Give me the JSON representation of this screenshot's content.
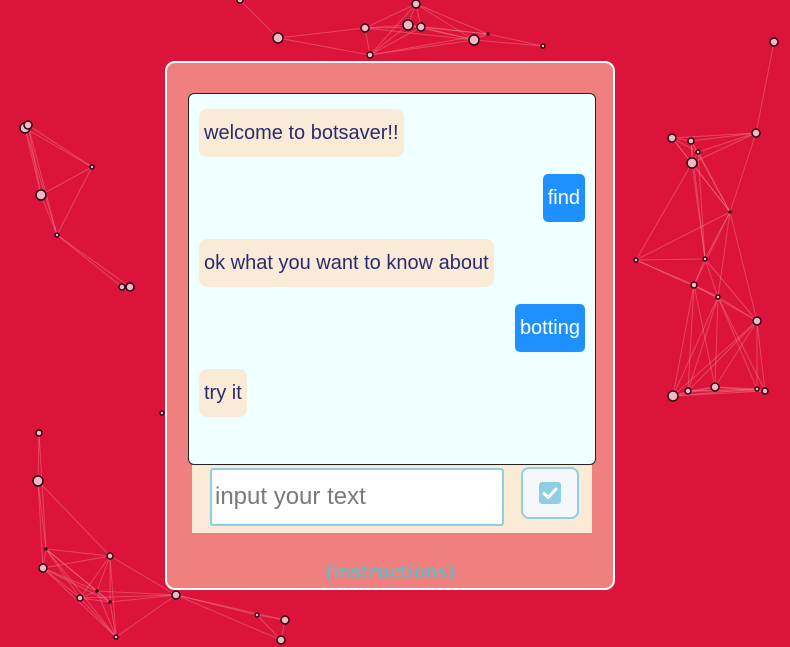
{
  "colors": {
    "background": "#dc143c",
    "panel": "#f08080",
    "chat_background": "#f0ffff",
    "bot_bubble": "#faebd7",
    "user_bubble": "#1e90ff",
    "link": "#23d5e0"
  },
  "chat": {
    "messages": [
      {
        "sender": "bot",
        "text": "welcome to botsaver!!"
      },
      {
        "sender": "user",
        "text": "find"
      },
      {
        "sender": "bot",
        "text": "ok what you want to know about"
      },
      {
        "sender": "user",
        "text": "botting"
      },
      {
        "sender": "bot",
        "text": "try it"
      }
    ]
  },
  "composer": {
    "placeholder": "input your text",
    "value": "",
    "send_icon": "checkbox-check-icon"
  },
  "footer": {
    "link_text": "(instructions)"
  }
}
